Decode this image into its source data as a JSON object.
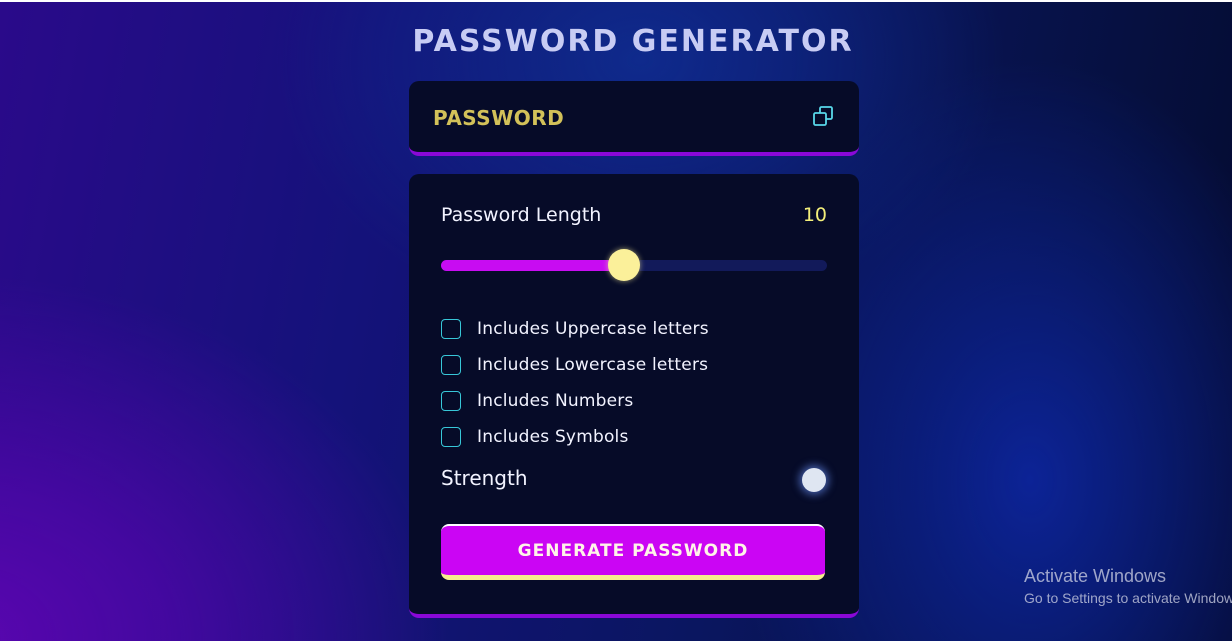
{
  "app": {
    "title": "PASSWORD GENERATOR"
  },
  "password_display": {
    "text": "PASSWORD",
    "copy_icon": "copy-icon"
  },
  "length": {
    "label": "Password Length",
    "value": "10",
    "slider_fraction": 0.475
  },
  "options": [
    {
      "label": "Includes Uppercase letters",
      "checked": false
    },
    {
      "label": "Includes Lowercase letters",
      "checked": false
    },
    {
      "label": "Includes Numbers",
      "checked": false
    },
    {
      "label": "Includes Symbols",
      "checked": false
    }
  ],
  "strength": {
    "label": "Strength",
    "indicator_color": "#dfe6f2"
  },
  "generate_button": {
    "label": "GENERATE PASSWORD"
  },
  "watermark": {
    "title": "Activate Windows",
    "subtitle": "Go to Settings to activate Windows."
  },
  "colors": {
    "accent": "#cb05f4",
    "highlight": "#f3ef7a",
    "checkbox_border": "#38c7d8",
    "card_bg": "#060b28"
  }
}
